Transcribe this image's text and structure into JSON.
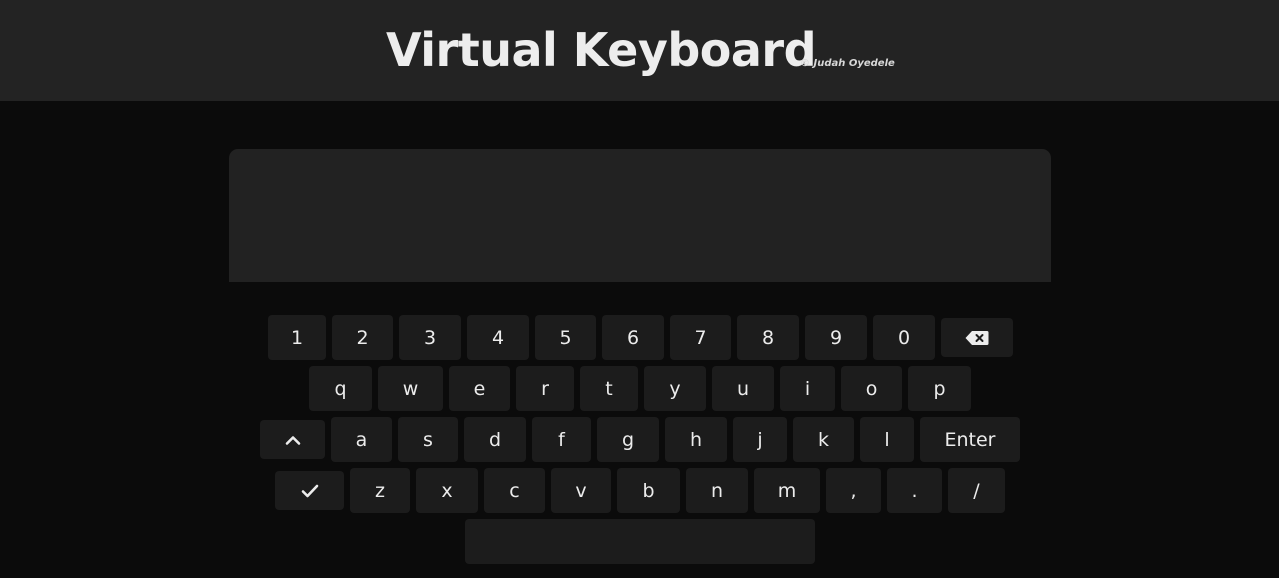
{
  "header": {
    "title": "Virtual Keyboard",
    "credit": "© Judah Oyedele"
  },
  "textarea": {
    "value": ""
  },
  "keyboard": {
    "row1": [
      "1",
      "2",
      "3",
      "4",
      "5",
      "6",
      "7",
      "8",
      "9",
      "0"
    ],
    "row2": [
      "q",
      "w",
      "e",
      "r",
      "t",
      "y",
      "u",
      "i",
      "o",
      "p"
    ],
    "row3": [
      "a",
      "s",
      "d",
      "f",
      "g",
      "h",
      "j",
      "k",
      "l"
    ],
    "row4": [
      "z",
      "x",
      "c",
      "v",
      "b",
      "n",
      "m",
      ",",
      ".",
      "/"
    ],
    "enter_label": "Enter",
    "icons": {
      "backspace": "backspace-icon",
      "caps": "chevron-up-icon",
      "done": "checkmark-icon"
    }
  }
}
